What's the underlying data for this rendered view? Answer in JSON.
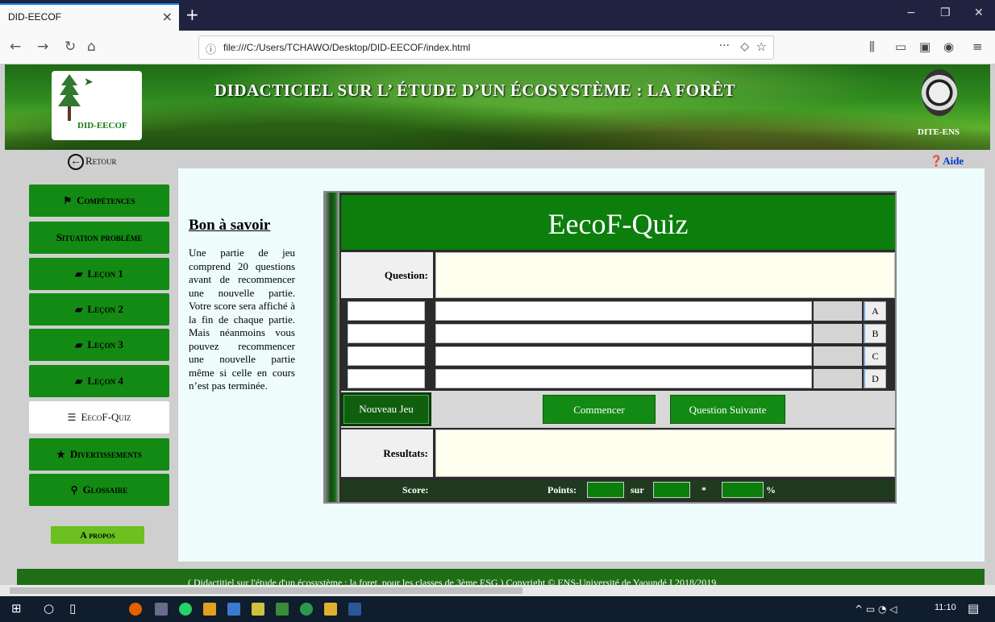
{
  "browser": {
    "tab_title": "DID-EECOF",
    "tab_close": "×",
    "new_tab": "+",
    "url_info_icon": "ⓘ",
    "url": "file:///C:/Users/TCHAWO/Desktop/DID-EECOF/index.html",
    "page_actions": "···",
    "win_minimize": "−",
    "win_restore": "❐",
    "win_close": "✕"
  },
  "banner": {
    "logo_text": "DID-EECOF",
    "title": "DIDACTICIEL SUR L’ ÉTUDE D’UN ÉCOSYSTÈME : LA FORÊT",
    "seal_text": "DITE-ENS"
  },
  "nav": {
    "retour": "Retour",
    "aide": "Aide"
  },
  "sidebar": {
    "items": [
      {
        "label": "Compétences",
        "icon": "flag-icon"
      },
      {
        "label": "Situation problème",
        "icon": ""
      },
      {
        "label": "Leçon 1",
        "icon": "book-icon"
      },
      {
        "label": "Leçon 2",
        "icon": "book-icon"
      },
      {
        "label": "Leçon 3",
        "icon": "book-icon"
      },
      {
        "label": "Leçon 4",
        "icon": "book-icon"
      },
      {
        "label": "EecoF-Quiz",
        "icon": "list-icon"
      },
      {
        "label": "Divertissements",
        "icon": "star-icon"
      },
      {
        "label": "Glossaire",
        "icon": "search-icon"
      }
    ],
    "apropos": "A propos"
  },
  "bon_a_savoir": {
    "title": "Bon à savoir",
    "text": "Une partie de jeu comprend 20 questions avant de recommencer une nouvelle partie. Votre score sera affiché à la fin de chaque partie. Mais néanmoins vous pouvez recommencer une nouvelle partie même si celle en cours n’est pas terminée."
  },
  "quiz": {
    "title": "EecoF-Quiz",
    "question_label": "Question:",
    "answers": [
      "A",
      "B",
      "C",
      "D"
    ],
    "nouveau_jeu": "Nouveau Jeu",
    "commencer": "Commencer",
    "question_suivante": "Question Suivante",
    "resultats_label": "Resultats:",
    "score_label": "Score:",
    "points_label": "Points:",
    "sur_label": "sur",
    "star_label": "*",
    "percent_label": "%"
  },
  "footer": {
    "text": "( Didactitiel sur l'étude d'un écosystème : la foret, pour les classes de 3ème ESG )  Copyright © ENS-Université de Yaoundé I  2018/2019"
  },
  "taskbar": {
    "time": "11:10"
  },
  "colors": {
    "green": "#138a13",
    "quiz_header": "#0b7e0b",
    "panel_bg": "#eefcfc",
    "help_blue": "#0033cc"
  }
}
